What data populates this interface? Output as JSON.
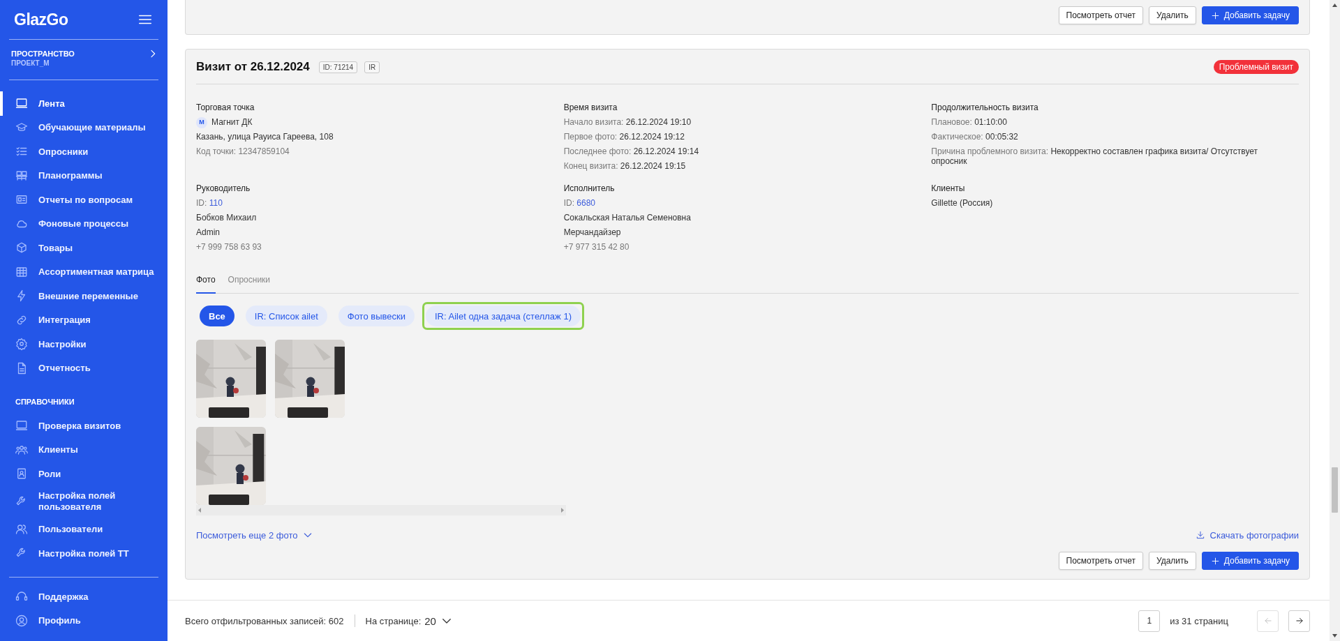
{
  "sidebar": {
    "logo": "GlazGo",
    "workspace": {
      "label": "ПРОСТРАНСТВО",
      "value": "ПРОЕКТ_М"
    },
    "items": [
      {
        "label": "Лента",
        "selected": true
      },
      {
        "label": "Обучающие материалы",
        "selected": false
      },
      {
        "label": "Опросники",
        "selected": false
      },
      {
        "label": "Планограммы",
        "selected": false
      },
      {
        "label": "Отчеты по вопросам",
        "selected": false
      },
      {
        "label": "Фоновые процессы",
        "selected": false
      },
      {
        "label": "Товары",
        "selected": false
      },
      {
        "label": "Ассортиментная матрица",
        "selected": false
      },
      {
        "label": "Внешние переменные",
        "selected": false
      },
      {
        "label": "Интеграция",
        "selected": false
      },
      {
        "label": "Настройки",
        "selected": false
      },
      {
        "label": "Отчетность",
        "selected": false
      }
    ],
    "section_title": "СПРАВОЧНИКИ",
    "reference_items": [
      {
        "label": "Проверка визитов",
        "selected": false
      },
      {
        "label": "Клиенты",
        "selected": false
      },
      {
        "label": "Роли",
        "selected": false
      },
      {
        "label": "Настройка полей пользователя",
        "selected": false
      },
      {
        "label": "Пользователи",
        "selected": false
      },
      {
        "label": "Настройка полей ТТ",
        "selected": false
      }
    ],
    "footer_items": [
      {
        "label": "Поддержка",
        "selected": false
      },
      {
        "label": "Профиль",
        "selected": false
      }
    ]
  },
  "previous_card": {
    "buttons": [
      {
        "label": "Посмотреть отчет",
        "kind": "default"
      },
      {
        "label": "Удалить",
        "kind": "default"
      },
      {
        "label": "Добавить задачу",
        "kind": "primary"
      }
    ]
  },
  "visit": {
    "title": "Визит от 26.12.2024",
    "tags": [
      "ID: 71214",
      "IR"
    ],
    "status": "Проблемный визит",
    "sections": [
      {
        "title": "Торговая точка",
        "lines": [
          {
            "kind": "store",
            "badge": "М",
            "text": "Магнит ДК"
          },
          {
            "kind": "text",
            "text": "Казань, улица Рауиса Гареева, 108"
          },
          {
            "kind": "muted",
            "text": "Код точки: 12347859104"
          }
        ]
      },
      {
        "title": "Время визита",
        "lines": [
          {
            "kind": "pair",
            "label": "Начало визита:",
            "value": "26.12.2024 19:10"
          },
          {
            "kind": "pair",
            "label": "Первое фото:",
            "value": "26.12.2024 19:12"
          },
          {
            "kind": "pair",
            "label": "Последнее фото:",
            "value": "26.12.2024 19:14"
          },
          {
            "kind": "pair",
            "label": "Конец визита:",
            "value": "26.12.2024 19:15"
          }
        ]
      },
      {
        "title": "Продолжительность визита",
        "lines": [
          {
            "kind": "pair",
            "label": "Плановое:",
            "value": "01:10:00"
          },
          {
            "kind": "pair",
            "label": "Фактическое:",
            "value": "00:05:32"
          },
          {
            "kind": "pair",
            "label": "Причина проблемного визита:",
            "value": "Некорректно составлен графика визита/ Отсутствует опросник"
          }
        ]
      },
      {
        "title": "Руководитель",
        "lines": [
          {
            "kind": "link",
            "label": "ID:",
            "value": "110"
          },
          {
            "kind": "text",
            "text": "Бобков Михаил"
          },
          {
            "kind": "text",
            "text": "Admin"
          },
          {
            "kind": "muted",
            "text": "+7 999 758 63 93"
          }
        ]
      },
      {
        "title": "Исполнитель",
        "lines": [
          {
            "kind": "link",
            "label": "ID:",
            "value": "6680"
          },
          {
            "kind": "text",
            "text": "Сокальская Наталья Семеновна"
          },
          {
            "kind": "text",
            "text": "Мерчандайзер"
          },
          {
            "kind": "muted",
            "text": "+7 977 315 42 80"
          }
        ]
      },
      {
        "title": "Клиенты",
        "lines": [
          {
            "kind": "text",
            "text": "Gillette (Россия)"
          }
        ]
      }
    ],
    "tabs": [
      {
        "label": "Фото",
        "selected": true
      },
      {
        "label": "Опросники",
        "selected": false
      }
    ],
    "filters": [
      {
        "label": "Все",
        "selected": true,
        "highlighted": false
      },
      {
        "label": "IR: Список ailet",
        "selected": false,
        "highlighted": false
      },
      {
        "label": "Фото вывески",
        "selected": false,
        "highlighted": false
      },
      {
        "label": "IR: Ailet одна задача (стеллаж 1)",
        "selected": false,
        "highlighted": true
      }
    ],
    "photos": [
      {
        "kind": "picture"
      },
      {
        "kind": "picture"
      },
      {
        "kind": "picture"
      }
    ],
    "more_link": "Посмотреть еще 2 фото",
    "download_link": "Скачать фотографии",
    "buttons": [
      {
        "label": "Посмотреть отчет",
        "kind": "default"
      },
      {
        "label": "Удалить",
        "kind": "default"
      },
      {
        "label": "Добавить задачу",
        "kind": "primary"
      }
    ]
  },
  "footer": {
    "total_text": "Всего отфильтрованных записей: 602",
    "per_page_label": "На странице:",
    "per_page": "20",
    "page": "1",
    "pages_text": "из 31 страниц",
    "pager_buttons": [
      {
        "kind": "prev",
        "disabled": true
      },
      {
        "kind": "next",
        "disabled": false
      }
    ]
  }
}
